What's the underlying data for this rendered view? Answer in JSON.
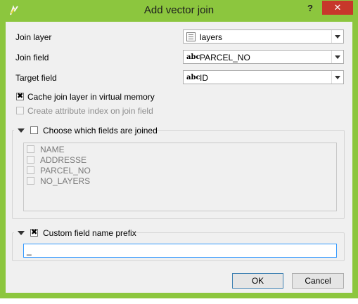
{
  "window": {
    "title": "Add vector join",
    "help_label": "?",
    "close_label": "✕"
  },
  "form": {
    "join_layer": {
      "label": "Join layer",
      "value": "layers",
      "icon": "vector-table-icon"
    },
    "join_field": {
      "label": "Join field",
      "value": "PARCEL_NO",
      "type_badge": "abc"
    },
    "target_field": {
      "label": "Target field",
      "value": "ID",
      "type_badge": "abc"
    }
  },
  "options": {
    "cache_label": "Cache join layer in virtual memory",
    "cache_checked": true,
    "index_label": "Create attribute index on join field",
    "index_checked": false
  },
  "fields_group": {
    "title": "Choose which fields are joined",
    "checked": false,
    "fields": [
      "NAME",
      "ADDRESSE",
      "PARCEL_NO",
      "NO_LAYERS"
    ]
  },
  "prefix_group": {
    "title": "Custom field name prefix",
    "checked": true,
    "value": "_"
  },
  "buttons": {
    "ok": "OK",
    "cancel": "Cancel"
  }
}
